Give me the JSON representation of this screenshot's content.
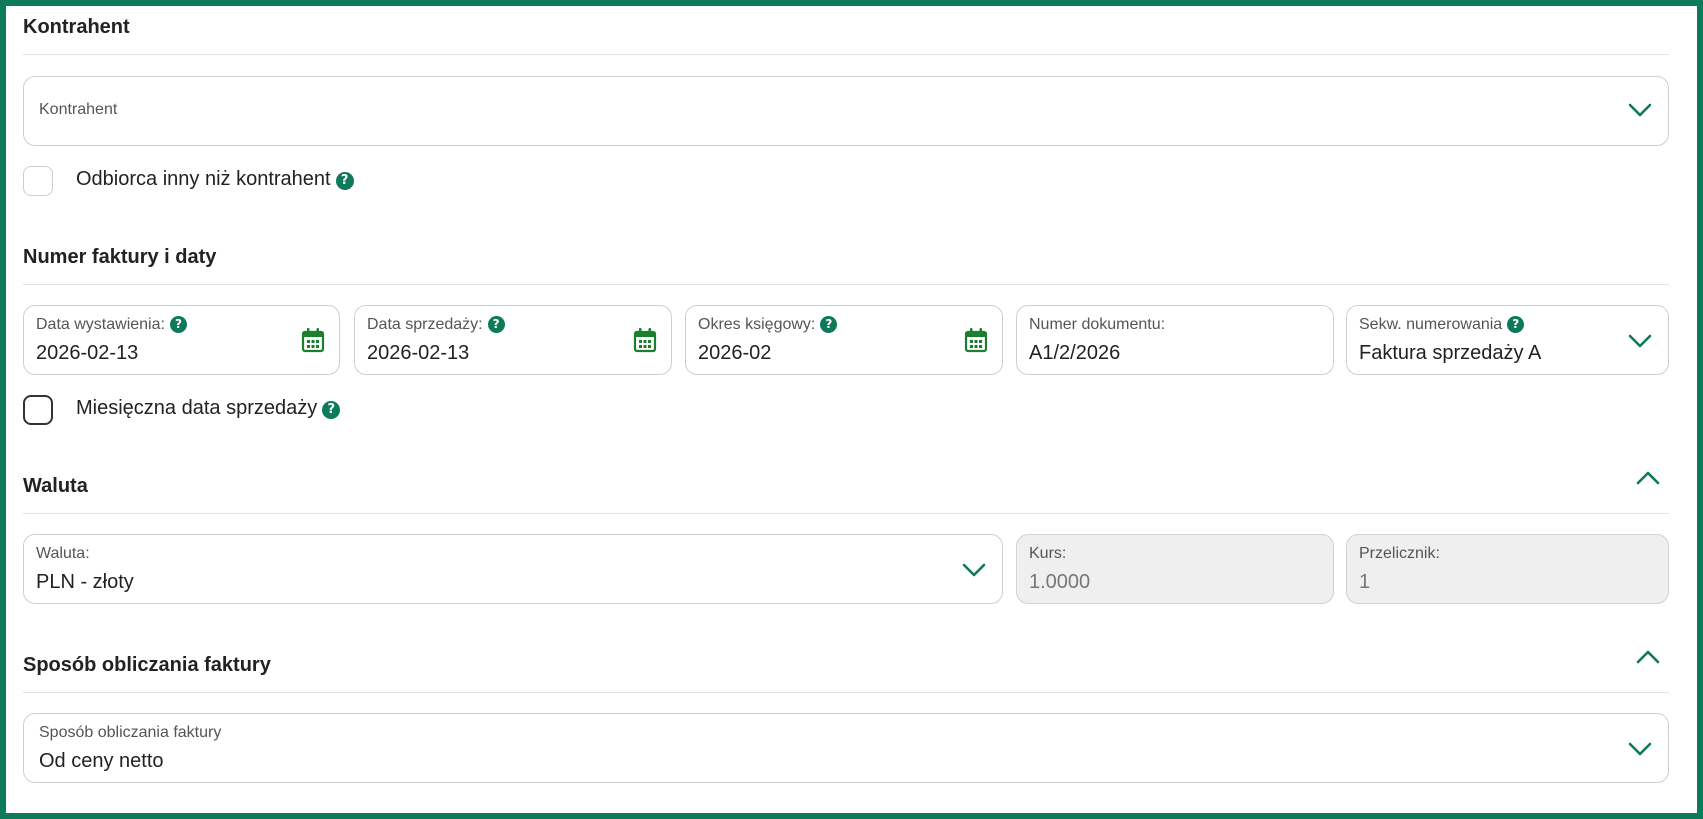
{
  "contractor": {
    "section_title": "Kontrahent",
    "select_placeholder": "Kontrahent",
    "other_recipient_label": "Odbiorca inny niż kontrahent"
  },
  "invoice_dates": {
    "section_title": "Numer faktury i daty",
    "issue_date": {
      "label": "Data wystawienia:",
      "value": "2026-02-13"
    },
    "sale_date": {
      "label": "Data sprzedaży:",
      "value": "2026-02-13"
    },
    "accounting_period": {
      "label": "Okres księgowy:",
      "value": "2026-02"
    },
    "document_number": {
      "label": "Numer dokumentu:",
      "value": "A1/2/2026"
    },
    "numbering_sequence": {
      "label": "Sekw. numerowania",
      "value": "Faktura sprzedaży A"
    },
    "monthly_sale_date_label": "Miesięczna data sprzedaży"
  },
  "currency": {
    "section_title": "Waluta",
    "currency_field": {
      "label": "Waluta:",
      "value": "PLN - złoty"
    },
    "rate_field": {
      "label": "Kurs:",
      "value": "1.0000"
    },
    "converter_field": {
      "label": "Przelicznik:",
      "value": "1"
    }
  },
  "calculation": {
    "section_title": "Sposób obliczania faktury",
    "method_field": {
      "label": "Sposób obliczania faktury",
      "value": "Od ceny netto"
    }
  },
  "icons": {
    "help_glyph": "?",
    "chevron": "chevron-down-icon",
    "calendar": "calendar-icon"
  },
  "colors": {
    "accent": "#0d7a5a",
    "calendar_green": "#1a7f2e"
  }
}
